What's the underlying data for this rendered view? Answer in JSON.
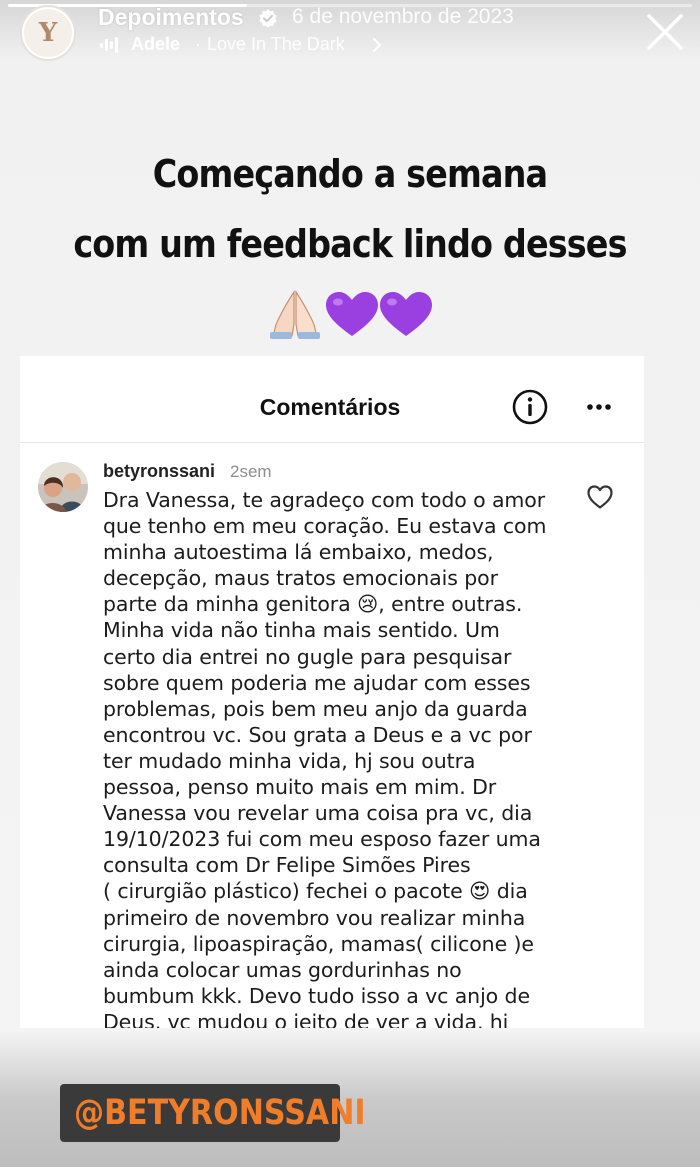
{
  "story": {
    "progress": 0.35,
    "account_name": "Depoimentos",
    "date": "6 de novembro de 2023",
    "music": {
      "artist": "Adele",
      "separator": "·",
      "song": "Love In The Dark"
    },
    "icons": {
      "verified": "verified-badge-icon",
      "music": "music-bars-icon",
      "close": "close-icon"
    }
  },
  "headline": {
    "line1": "Começando a semana",
    "line2": "com um feedback lindo desses",
    "emojis": "🙏🏻💜💜"
  },
  "comments_panel": {
    "title": "Comentários",
    "comment": {
      "username": "betyronssani",
      "time": "2sem",
      "text": "Dra Vanessa, te agradeço com todo o amor\nque tenho em meu coração. Eu estava com\nminha autoestima lá embaixo, medos,\ndecepção, maus tratos emocionais por\nparte da minha genitora 😢, entre outras.\nMinha vida não tinha mais sentido. Um\ncerto dia entrei no gugle para pesquisar\nsobre quem poderia me ajudar com esses\nproblemas, pois bem meu anjo da guarda\nencontrou vc. Sou grata a Deus e a vc por\nter mudado minha vida, hj sou outra\npessoa, penso muito mais em mim. Dr\nVanessa vou revelar uma coisa pra vc, dia\n19/10/2023 fui com meu esposo fazer uma\nconsulta com Dr Felipe Simões Pires\n( cirurgião plástico) fechei o pacote 😍 dia\nprimeiro de novembro vou realizar minha\ncirurgia, lipoaspiração, mamas( cilicone )e\nainda colocar umas gordurinhas no\nbumbum kkk. Devo tudo isso a vc anjo de\nDeus, vc mudou o jeito de ver a vida, hj"
    }
  },
  "mention": {
    "text": "@BETYRONSSANI",
    "color": "#f07d2a"
  },
  "colors": {
    "background": "#f1f1f1",
    "panel": "#ffffff",
    "text": "#111111",
    "muted": "#8e8e8e"
  }
}
